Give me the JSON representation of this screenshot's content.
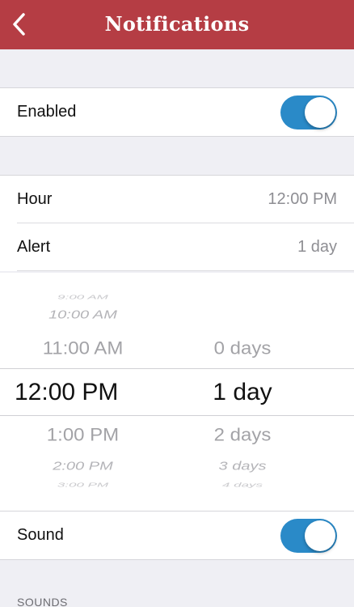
{
  "header": {
    "title": "Notifications"
  },
  "enabled": {
    "label": "Enabled",
    "on": true
  },
  "settings": {
    "hour": {
      "label": "Hour",
      "value": "12:00 PM"
    },
    "alert": {
      "label": "Alert",
      "value": "1 day"
    }
  },
  "picker": {
    "hours": [
      "9:00 AM",
      "10:00 AM",
      "11:00 AM",
      "12:00 PM",
      "1:00 PM",
      "2:00 PM",
      "3:00 PM"
    ],
    "days": [
      "0 days",
      "1 day",
      "2 days",
      "3 days",
      "4 days"
    ],
    "selected_hour": "12:00 PM",
    "selected_day": "1 day"
  },
  "sound": {
    "label": "Sound",
    "on": true
  },
  "sounds_header": "SOUNDS",
  "colors": {
    "header": "#b53d44",
    "toggle_on": "#2a8ac8",
    "background": "#efeff4"
  }
}
